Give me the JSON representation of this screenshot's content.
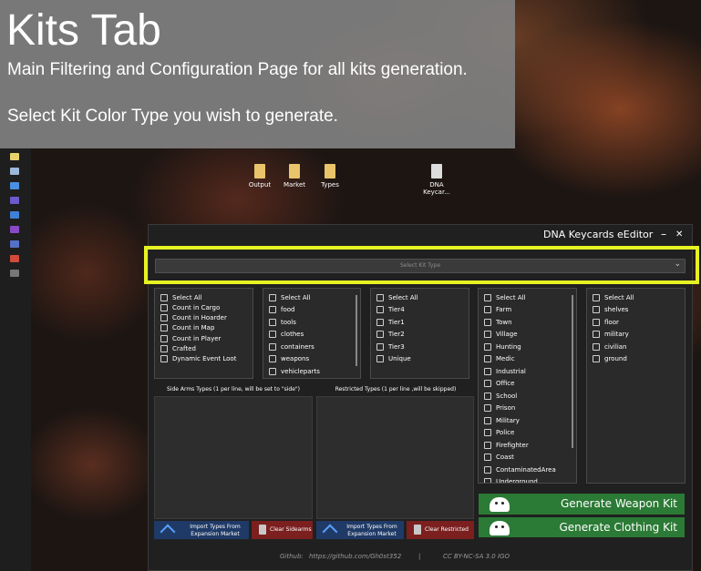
{
  "overlay": {
    "title": "Kits Tab",
    "line1": "Main Filtering and Configuration Page for all kits generation.",
    "line2": "Select Kit Color Type you wish to generate."
  },
  "desktop": {
    "icons": [
      {
        "label": "Output"
      },
      {
        "label": "Market"
      },
      {
        "label": "Types"
      },
      {
        "label": "DNA Keycar..."
      }
    ]
  },
  "window": {
    "title": "DNA Keycards eEditor",
    "minimize": "–",
    "close": "✕"
  },
  "kit_type": {
    "placeholder": "Select Kit Type",
    "chevron": "⌄"
  },
  "flags": {
    "items": [
      "Select All",
      "Count in Cargo",
      "Count in Hoarder",
      "Count in Map",
      "Count in Player",
      "Crafted",
      "Dynamic Event Loot"
    ]
  },
  "categories": {
    "items": [
      "Select All",
      "food",
      "tools",
      "clothes",
      "containers",
      "weapons",
      "vehicleparts"
    ]
  },
  "tiers": {
    "items": [
      "Select All",
      "Tier4",
      "Tier1",
      "Tier2",
      "Tier3",
      "Unique"
    ]
  },
  "usages": {
    "items": [
      "Select All",
      "Farm",
      "Town",
      "Village",
      "Hunting",
      "Medic",
      "Industrial",
      "Office",
      "School",
      "Prison",
      "Military",
      "Police",
      "Firefighter",
      "Coast",
      "ContaminatedArea",
      "Underground"
    ]
  },
  "values": {
    "items": [
      "Select All",
      "shelves",
      "floor",
      "military",
      "civilian",
      "ground"
    ]
  },
  "side_arms": {
    "label": "Side Arms Types (1 per line, will be set to \"side\")",
    "import_label": "Import Types From Expansion Market",
    "clear_label": "Clear Sidearms"
  },
  "restricted": {
    "label": "Restricted Types (1 per line ,will be skipped)",
    "import_label": "Import Types From Expansion Market",
    "clear_label": "Clear Restricted"
  },
  "actions": {
    "generate_weapon": "Generate Weapon Kit",
    "generate_clothing": "Generate Clothing Kit"
  },
  "footer": {
    "github_label": "Github:",
    "github_url": "https://github.com/Gh0st352",
    "separator": "|",
    "license": "CC BY-NC-SA 3.0 IGO"
  },
  "colors": {
    "highlight": "#e7f222",
    "generate": "#2b7a35",
    "clear": "#7b1f1f",
    "import": "#1f3a66"
  }
}
